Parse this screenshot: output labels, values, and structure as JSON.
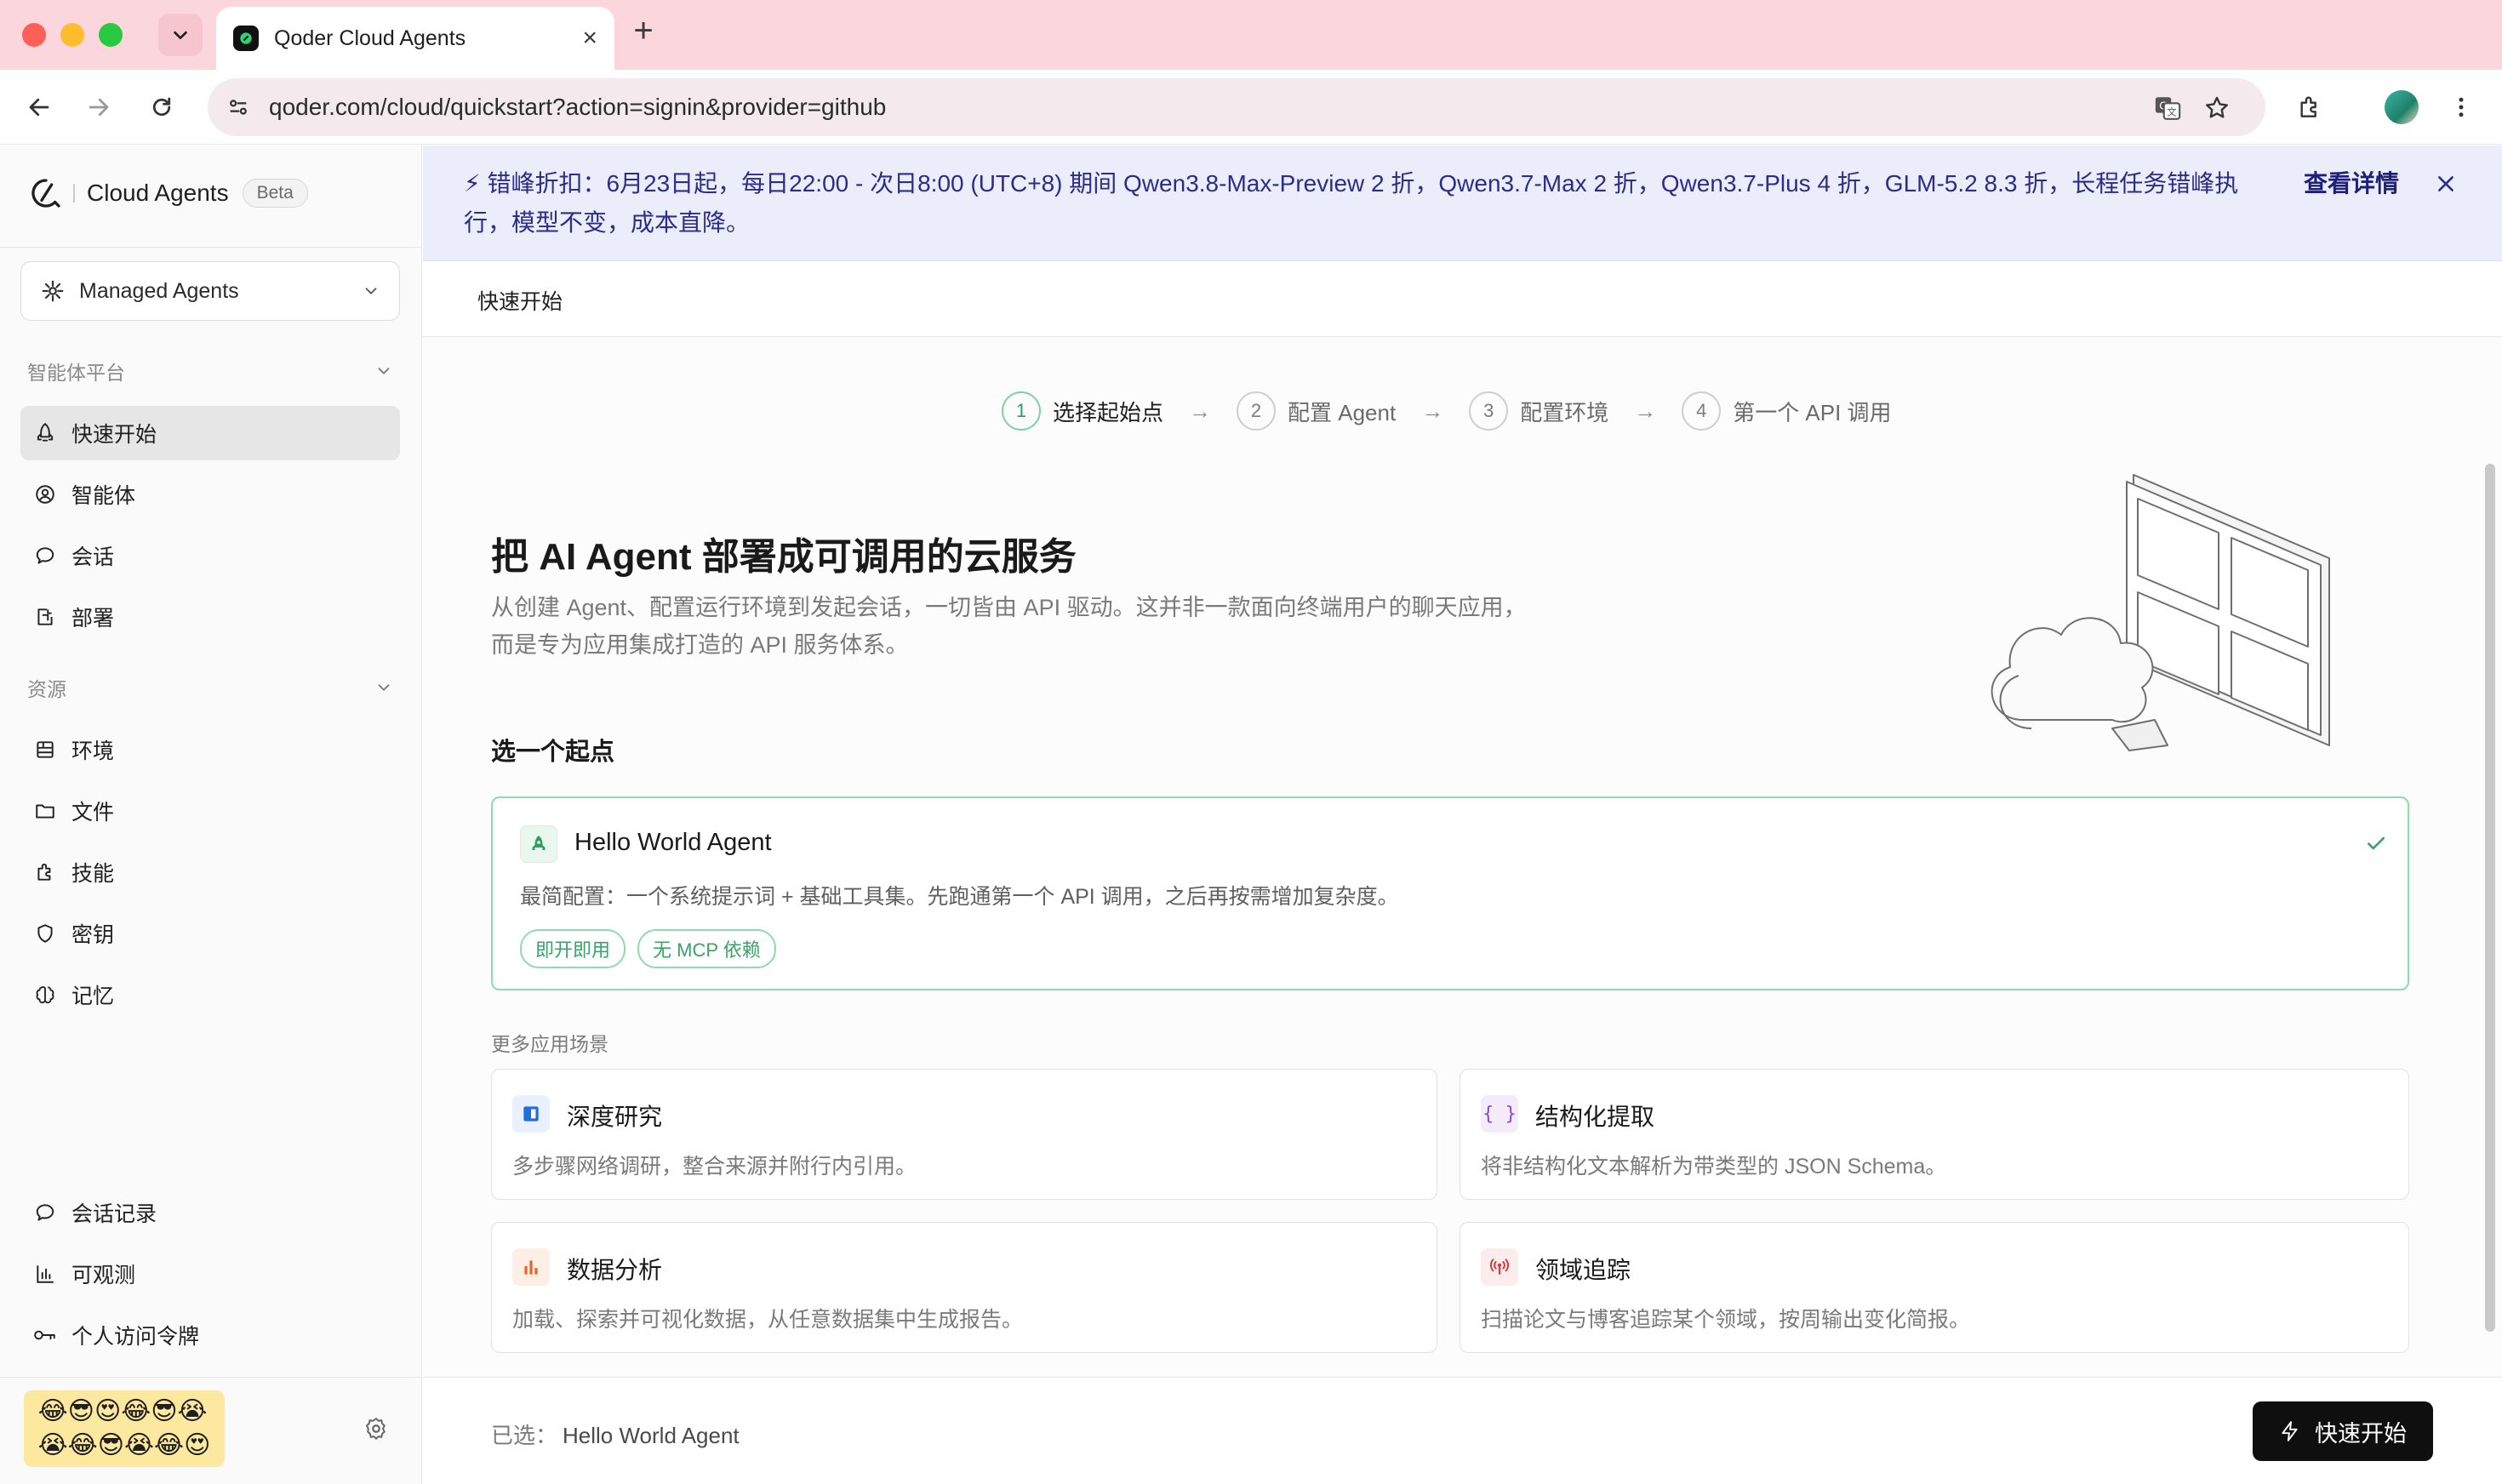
{
  "browser": {
    "tab_title": "Qoder Cloud Agents",
    "url": "qoder.com/cloud/quickstart?action=signin&provider=github"
  },
  "sidebar": {
    "brand": "Cloud Agents",
    "badge": "Beta",
    "selector": "Managed Agents",
    "section_platform": "智能体平台",
    "platform_items": [
      {
        "label": "快速开始",
        "icon": "rocket-icon"
      },
      {
        "label": "智能体",
        "icon": "agent-icon"
      },
      {
        "label": "会话",
        "icon": "chat-bubble-icon"
      },
      {
        "label": "部署",
        "icon": "deploy-icon"
      }
    ],
    "section_resources": "资源",
    "resource_items": [
      {
        "label": "环境",
        "icon": "environment-icon"
      },
      {
        "label": "文件",
        "icon": "folder-icon"
      },
      {
        "label": "技能",
        "icon": "puzzle-icon"
      },
      {
        "label": "密钥",
        "icon": "shield-icon"
      },
      {
        "label": "记忆",
        "icon": "brain-icon"
      }
    ],
    "bottom_items": [
      {
        "label": "会话记录",
        "icon": "chat-history-icon"
      },
      {
        "label": "可观测",
        "icon": "bar-chart-icon"
      },
      {
        "label": "个人访问令牌",
        "icon": "key-icon"
      }
    ]
  },
  "banner": {
    "text": "⚡ 错峰折扣：6月23日起，每日22:00 - 次日8:00 (UTC+8) 期间 Qwen3.8-Max-Preview 2 折，Qwen3.7-Max 2 折，Qwen3.7-Plus 4 折，GLM-5.2 8.3 折，长程任务错峰执行，模型不变，成本直降。",
    "link": "查看详情"
  },
  "page": {
    "header_title": "快速开始",
    "steps": [
      {
        "num": "1",
        "label": "选择起始点"
      },
      {
        "num": "2",
        "label": "配置 Agent"
      },
      {
        "num": "3",
        "label": "配置环境"
      },
      {
        "num": "4",
        "label": "第一个 API 调用"
      }
    ],
    "hero_title": "把 AI Agent 部署成可调用的云服务",
    "hero_desc_1": "从创建 Agent、配置运行环境到发起会话，一切皆由 API 驱动。这并非一款面向终端用户的聊天应用，",
    "hero_desc_2": "而是专为应用集成打造的 API 服务体系。",
    "pick_title": "选一个起点",
    "selected_card": {
      "title": "Hello World Agent",
      "desc": "最简配置：一个系统提示词 + 基础工具集。先跑通第一个 API 调用，之后再按需增加复杂度。",
      "tags": [
        "即开即用",
        "无 MCP 依赖"
      ]
    },
    "more_title": "更多应用场景",
    "scenarios": [
      {
        "title": "深度研究",
        "desc": "多步骤网络调研，整合来源并附行内引用。",
        "icon": "book-icon"
      },
      {
        "title": "结构化提取",
        "desc": "将非结构化文本解析为带类型的 JSON Schema。",
        "icon": "braces-icon"
      },
      {
        "title": "数据分析",
        "desc": "加载、探索并可视化数据，从任意数据集中生成报告。",
        "icon": "bar-chart-icon"
      },
      {
        "title": "领域追踪",
        "desc": "扫描论文与博客追踪某个领域，按周输出变化简报。",
        "icon": "broadcast-icon"
      }
    ]
  },
  "footer": {
    "selected_prefix": "已选：",
    "selected_value": "Hello World Agent",
    "start_button": "快速开始"
  },
  "colors": {
    "accent_green": "#38a36a",
    "banner_bg": "#ecedfb",
    "banner_text": "#2c2c8a",
    "primary_button": "#0f0f0f"
  }
}
